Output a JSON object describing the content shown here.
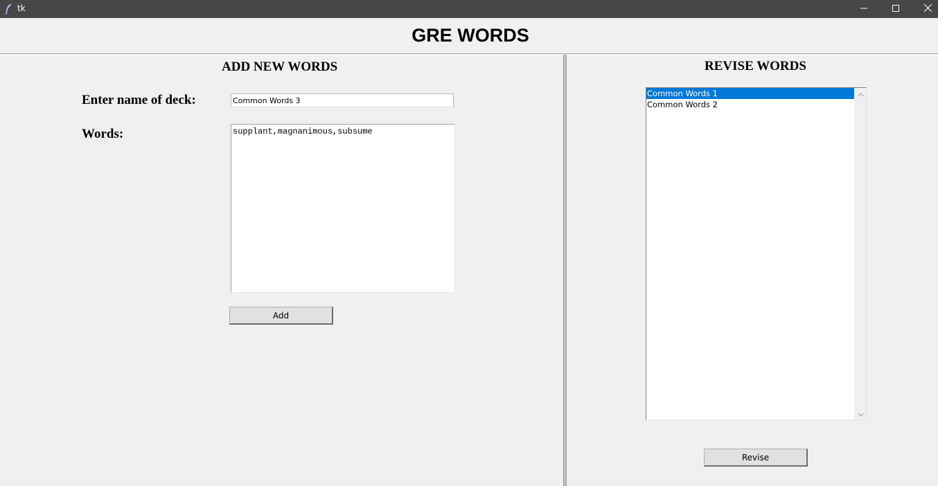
{
  "window": {
    "title": "tk"
  },
  "header": {
    "title": "GRE WORDS"
  },
  "add_panel": {
    "title": "ADD NEW WORDS",
    "deck_label": "Enter name of deck:",
    "deck_value": "Common Words 3",
    "words_label": "Words:",
    "words_value": "supplant,magnanimous,subsume",
    "add_label": "Add"
  },
  "revise_panel": {
    "title": "REVISE WORDS",
    "decks": [
      {
        "label": "Common Words 1",
        "selected": true
      },
      {
        "label": "Common Words 2",
        "selected": false
      }
    ],
    "revise_label": "Revise"
  },
  "colors": {
    "titlebar": "#474747",
    "selection": "#0078d7",
    "background": "#f0f0f0"
  },
  "icons": {
    "app": "feather-icon",
    "minimize": "minimize-icon",
    "maximize": "maximize-icon",
    "close": "close-icon",
    "scroll_up": "chevron-up-icon",
    "scroll_down": "chevron-down-icon"
  }
}
